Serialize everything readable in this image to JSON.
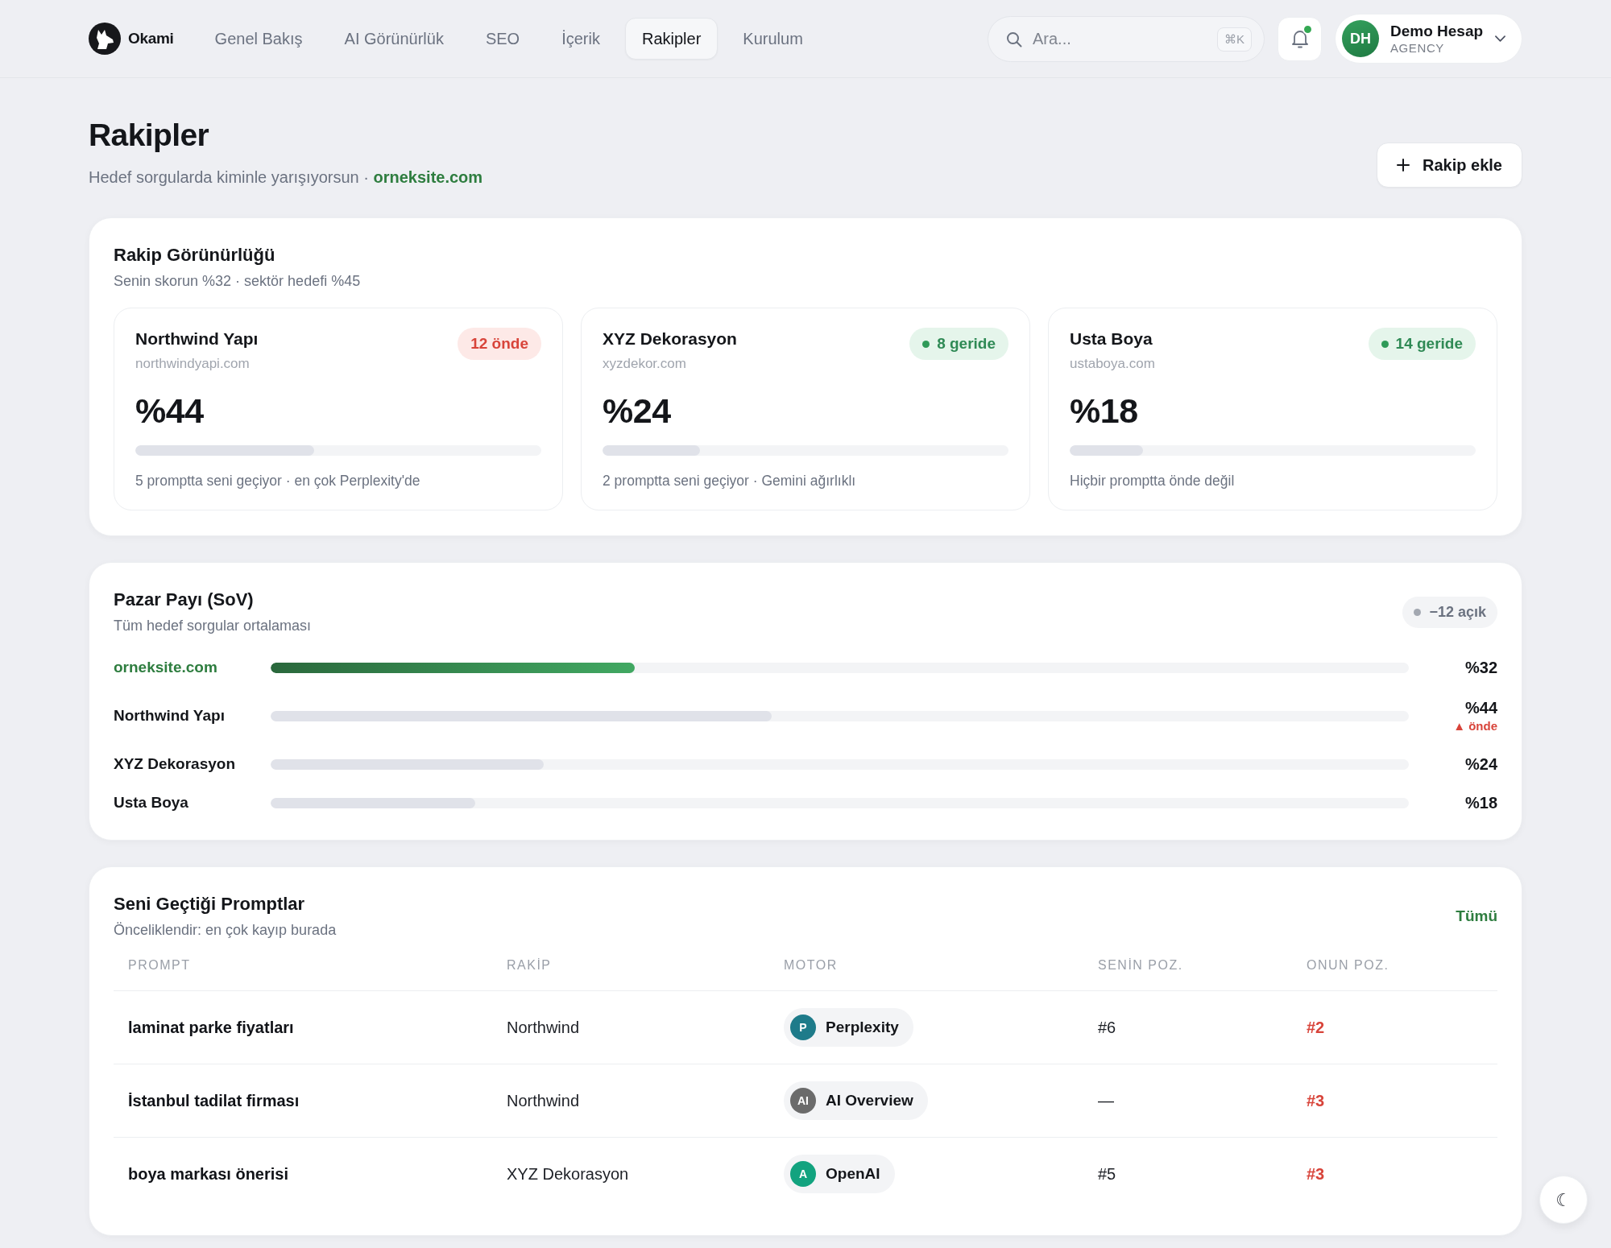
{
  "header": {
    "brand": "Okami",
    "nav": [
      {
        "label": "Genel Bakış",
        "selected": false
      },
      {
        "label": "AI Görünürlük",
        "selected": false
      },
      {
        "label": "SEO",
        "selected": false
      },
      {
        "label": "İçerik",
        "selected": false
      },
      {
        "label": "Rakipler",
        "selected": true
      },
      {
        "label": "Kurulum",
        "selected": false
      }
    ],
    "search": {
      "placeholder": "Ara...",
      "shortcut": "⌘K"
    },
    "notifications": {
      "unread": true
    },
    "account": {
      "initials": "DH",
      "name": "Demo Hesap",
      "plan": "AGENCY"
    }
  },
  "page": {
    "title": "Rakipler",
    "subtitle": "Hedef sorgularda kiminle yarışıyorsun · **orneksite.com**",
    "add_button": "Rakip ekle"
  },
  "visibility": {
    "title": "Rakip Görünürlüğü",
    "subtitle": "Senin skorun %32 · sektör hedefi %45",
    "competitors": [
      {
        "name": "Northwind Yapı",
        "domain": "northwindyapi.com",
        "badge": {
          "kind": "ahead",
          "label": "12 önde"
        },
        "score": "%44",
        "level": 0.44,
        "note": "5 promptta seni geçiyor · en çok Perplexity'de"
      },
      {
        "name": "XYZ Dekorasyon",
        "domain": "xyzdekor.com",
        "badge": {
          "kind": "behind",
          "label": "8 geride"
        },
        "score": "%24",
        "level": 0.24,
        "note": "2 promptta seni geçiyor · Gemini ağırlıklı"
      },
      {
        "name": "Usta Boya",
        "domain": "ustaboya.com",
        "badge": {
          "kind": "behind",
          "label": "14 geride"
        },
        "score": "%18",
        "level": 0.18,
        "note": "Hiçbir promptta önde değil"
      }
    ]
  },
  "share_of_voice": {
    "title": "Pazar Payı (SoV)",
    "subtitle": "Tüm hedef sorgular ortalaması",
    "gap_badge": "−12 açık",
    "rows": [
      {
        "kind": "own",
        "name": "orneksite.com",
        "level": 0.32,
        "value": "%32"
      },
      {
        "kind": "competitor",
        "name": "Northwind Yapı",
        "level": 0.44,
        "value": "%44",
        "note": "▲ önde"
      },
      {
        "kind": "competitor",
        "name": "XYZ Dekorasyon",
        "level": 0.24,
        "value": "%24"
      },
      {
        "kind": "competitor",
        "name": "Usta Boya",
        "level": 0.18,
        "value": "%18"
      }
    ]
  },
  "lost_prompts": {
    "title": "Seni Geçtiği Promptlar",
    "subtitle": "Önceliklendir: en çok kayıp burada",
    "link": "Tümü",
    "columns": [
      "PROMPT",
      "RAKİP",
      "MOTOR",
      "SENİN POZ.",
      "ONUN POZ."
    ],
    "rows": [
      {
        "prompt": "laminat parke fiyatları",
        "competitor": "Northwind",
        "engine": {
          "initials": "P",
          "name": "Perplexity",
          "color": "#1e7b8a"
        },
        "your_position": "#6",
        "their_position": "#2"
      },
      {
        "prompt": "İstanbul tadilat firması",
        "competitor": "Northwind",
        "engine": {
          "initials": "AI",
          "name": "AI Overview",
          "color": "#6b6b6b"
        },
        "your_position": "—",
        "their_position": "#3"
      },
      {
        "prompt": "boya markası önerisi",
        "competitor": "XYZ Dekorasyon",
        "engine": {
          "initials": "A",
          "name": "OpenAI",
          "color": "#12a37f"
        },
        "your_position": "#5",
        "their_position": "#3"
      }
    ]
  },
  "theme_toggle": {
    "glyph": "☾"
  }
}
